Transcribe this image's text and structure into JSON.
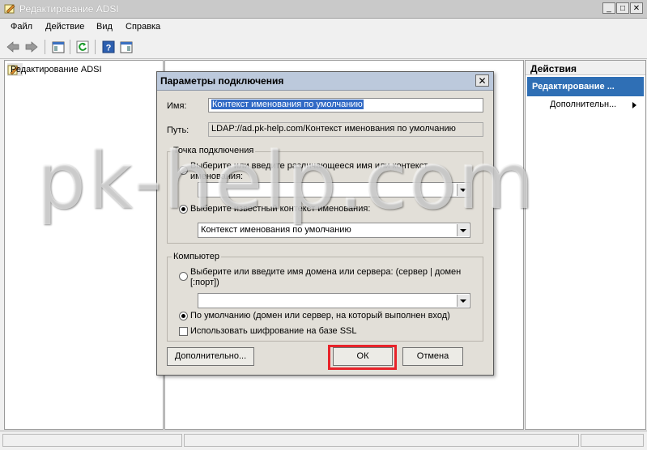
{
  "window": {
    "title": "Редактирование ADSI"
  },
  "menu": [
    "Файл",
    "Действие",
    "Вид",
    "Справка"
  ],
  "tree": {
    "root_label": "Редактирование ADSI"
  },
  "actions": {
    "header": "Действия",
    "section": "Редактирование ...",
    "item": "Дополнительн..."
  },
  "dialog": {
    "title": "Параметры подключения",
    "name_label": "Имя:",
    "name_value": "Контекст именования по умолчанию",
    "path_label": "Путь:",
    "path_value": "LDAP://ad.pk-help.com/Контекст именования по умолчанию",
    "connection_point": {
      "group_label": "Точка подключения",
      "option_distinguished": "Выберите или введите различающееся имя или контекст именования:",
      "option_known": "Выберите известный контекст именования:",
      "known_selected": "Контекст именования по умолчанию",
      "selected_option": "known"
    },
    "computer": {
      "group_label": "Компьютер",
      "option_select": "Выберите или введите имя домена или сервера: (сервер | домен [:порт])",
      "option_default": "По умолчанию (домен или сервер, на который выполнен вход)",
      "ssl_label": "Использовать шифрование на базе SSL",
      "selected_option": "default",
      "ssl_checked": false
    },
    "advanced_button": "Дополнительно...",
    "ok_button": "ОК",
    "cancel_button": "Отмена"
  },
  "watermark": "pk-help.com"
}
